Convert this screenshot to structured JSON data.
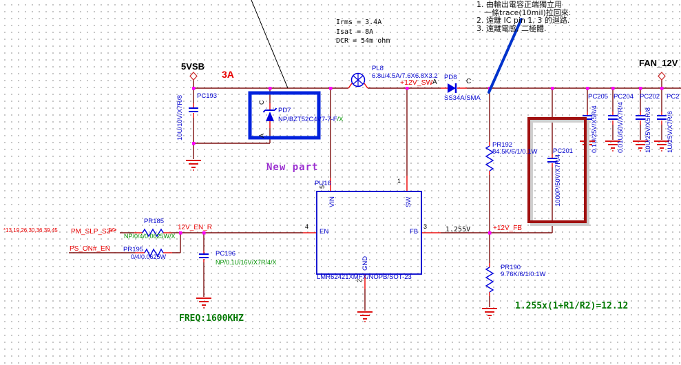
{
  "annotations": {
    "zh_note": {
      "line1": "1. 由輸出電容正端獨立用",
      "line2": "一條trace(10mil)拉回來.",
      "line3": "2. 遠離 IC pin 1, 3 的迴路.",
      "line4": "3. 遠離電感, 二極體."
    },
    "inductor_spec": {
      "line1": "Irms = 3.4A",
      "line2": "Isat = 8A",
      "line3": "DCR = 54m ohm"
    },
    "new_part": "New part",
    "freq": "FREQ:1600KHZ",
    "formula": "1.255x(1+R1/R2)=12.12",
    "current_rating": "3A",
    "fb_voltage": "1.255V"
  },
  "ports": {
    "input": "5VSB",
    "output": "FAN_12V"
  },
  "net_labels": {
    "sw": "+12V_SW",
    "en": "12V_EN_R",
    "fb": "+12V_FB",
    "pm_slp_s3": "PM_SLP_S3-",
    "pm_slp_s3_sheets": "*13,19,26,30,36,39,45",
    "ps_on_en": "PS_ON#_EN",
    "offpage_connector": ">>"
  },
  "components": {
    "pc193": {
      "ref": "PC193",
      "value": "10U/10V/X7R/8"
    },
    "pd7": {
      "ref": "PD7",
      "value": "NP/BZT52C4V7-7-F",
      "value_suffix": "/X",
      "cathode": "C",
      "anode": "A"
    },
    "pl8": {
      "ref": "PL8",
      "value": "6.8u/4.5A/7.6X6.8X3.2"
    },
    "pd8": {
      "ref": "PD8",
      "value": "SS34A/SMA",
      "anode": "A",
      "cathode": "C"
    },
    "pu16": {
      "ref": "PU16",
      "part": "LMR62421XMFX/NOPB/SOT-23",
      "pins": {
        "vin": {
          "name": "VIN",
          "num": "5"
        },
        "sw": {
          "name": "SW",
          "num": "1"
        },
        "en": {
          "name": "EN",
          "num": "4"
        },
        "fb": {
          "name": "FB",
          "num": "3"
        },
        "gnd": {
          "name": "GND",
          "num": "2"
        }
      }
    },
    "pr185": {
      "ref": "PR185",
      "value": "NP/0/4/0.0625W/X"
    },
    "pr195": {
      "ref": "PR195",
      "value": "0/4/0.0625W"
    },
    "pc196": {
      "ref": "PC196",
      "value": "NP/0.1U/16V/X7R/4/X"
    },
    "pr192": {
      "ref": "PR192",
      "value": "84.5K/6/1/0.1W"
    },
    "pr190": {
      "ref": "PR190",
      "value": "9.76K/6/1/0.1W"
    },
    "pc201": {
      "ref": "PC201",
      "value": "1000P/50V/X7R/4"
    },
    "pc205": {
      "ref": "PC205",
      "value": "0.1U/25V/X5R/4"
    },
    "pc204": {
      "ref": "PC204",
      "value": "0.01U/50V/X7R/4"
    },
    "pc202": {
      "ref": "PC202",
      "value": "10U/25V/X5R/8"
    },
    "pc2xx": {
      "ref": "PC2",
      "value": "1U/25V/X7R/6"
    }
  },
  "colors": {
    "wire": "#7c0d0d",
    "pin_lead": "#ee1111",
    "symbol_blue": "#0000dd",
    "designator_blue": "#0000cc",
    "net_label_red": "#e80000",
    "np_value_green": "#009100",
    "note_green": "#007700",
    "junction_magenta": "#ff00ff",
    "new_part_purple": "#9b30d0",
    "highlight_box_blue": "#0022dd",
    "highlight_box_maroon": "#a01010"
  }
}
